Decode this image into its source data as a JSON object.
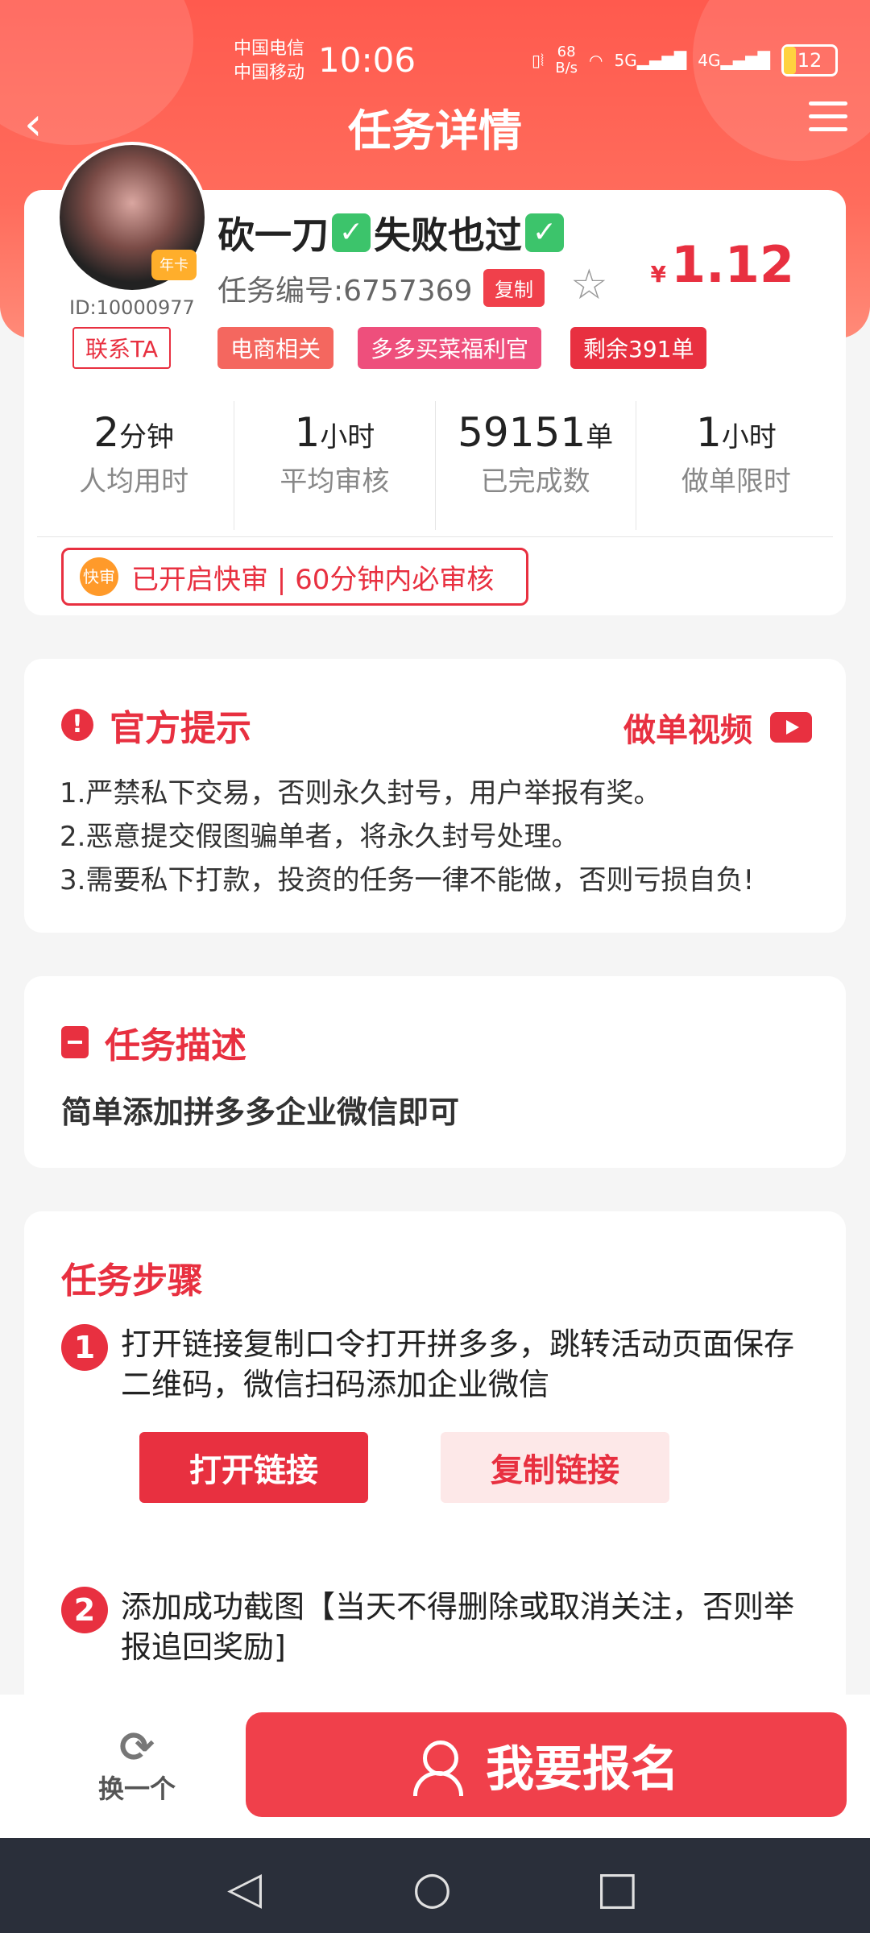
{
  "status_bar": {
    "carrier1": "中国电信",
    "carrier2": "中国移动",
    "time": "10:06",
    "speed_value": "68",
    "speed_unit": "B/s",
    "net1": "5G",
    "net2": "4G",
    "battery": "12"
  },
  "nav": {
    "title": "任务详情"
  },
  "task": {
    "user_id": "ID:10000977",
    "badge": "年卡",
    "title_a": "砍一刀",
    "title_b": "失败也过",
    "task_no": "任务编号:6757369",
    "copy_label": "复制",
    "price_symbol": "¥",
    "price": "1.12",
    "contact_label": "联系TA",
    "tags": [
      "电商相关",
      "多多买菜福利官",
      "剩余391单"
    ],
    "stats": [
      {
        "value": "2",
        "unit": "分钟",
        "label": "人均用时"
      },
      {
        "value": "1",
        "unit": "小时",
        "label": "平均审核"
      },
      {
        "value": "59151",
        "unit": "单",
        "label": "已完成数"
      },
      {
        "value": "1",
        "unit": "小时",
        "label": "做单限时"
      }
    ],
    "fast_icon": "快审",
    "fast_text": "已开启快审 | 60分钟内必审核"
  },
  "official": {
    "title": "官方提示",
    "video_label": "做单视频",
    "tips": [
      "1.严禁私下交易，否则永久封号，用户举报有奖。",
      "2.恶意提交假图骗单者，将永久封号处理。",
      "3.需要私下打款，投资的任务一律不能做，否则亏损自负!"
    ]
  },
  "description": {
    "title": "任务描述",
    "text": "简单添加拼多多企业微信即可"
  },
  "steps": {
    "title": "任务步骤",
    "items": [
      {
        "num": "1",
        "text": "打开链接复制口令打开拼多多，跳转活动页面保存二维码，微信扫码添加企业微信"
      },
      {
        "num": "2",
        "text": "添加成功截图【当天不得删除或取消关注，否则举报追回奖励]"
      }
    ],
    "open_link": "打开链接",
    "copy_link": "复制链接"
  },
  "bottom": {
    "swap_label": "换一个",
    "signup_label": "我要报名"
  },
  "colors": {
    "accent": "#e83040",
    "header": "#ff5a4e"
  }
}
